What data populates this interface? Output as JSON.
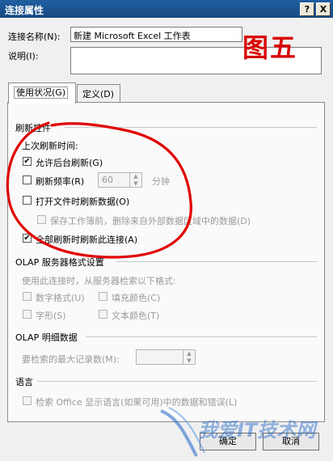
{
  "window": {
    "title": "连接属性",
    "help_button": "?",
    "close_button": "X"
  },
  "connection_name": {
    "label": "连接名称(N):",
    "value": "新建 Microsoft Excel 工作表"
  },
  "description": {
    "label": "说明(I):",
    "value": ""
  },
  "annotation": "图五",
  "tabs": [
    {
      "label": "使用状况(G)",
      "active": true
    },
    {
      "label": "定义(D)",
      "active": false
    }
  ],
  "refresh": {
    "group_title": "刷新控件",
    "last_refresh_label": "上次刷新时间:",
    "background_refresh": {
      "label": "允许后台刷新(G)",
      "checked": true
    },
    "refresh_every": {
      "label": "刷新频率(R)",
      "checked": false,
      "value": "60",
      "unit": "分钟"
    },
    "refresh_on_open": {
      "label": "打开文件时刷新数据(O)",
      "checked": false
    },
    "remove_external_data": {
      "label": "保存工作簿前，删除来自外部数据区域中的数据(D)",
      "checked": false,
      "disabled": true
    },
    "refresh_all": {
      "label": "全部刷新时刷新此连接(A)",
      "checked": true
    }
  },
  "olap_format": {
    "group_title": "OLAP 服务器格式设置",
    "description": "使用此连接时，从服务器检索以下格式:",
    "options": [
      {
        "label": "数字格式(U)",
        "checked": false
      },
      {
        "label": "填充颜色(C)",
        "checked": false
      },
      {
        "label": "字形(S)",
        "checked": false
      },
      {
        "label": "文本颜色(T)",
        "checked": false
      }
    ]
  },
  "olap_drill": {
    "group_title": "OLAP 明细数据",
    "max_records_label": "要检索的最大记录数(M):",
    "max_records_value": ""
  },
  "language": {
    "group_title": "语言",
    "office_language": {
      "label": "检索 Office 显示语言(如果可用)中的数据和错误(L)",
      "checked": false
    }
  },
  "buttons": {
    "ok": "确定",
    "cancel": "取消"
  },
  "watermark": "我爱IT技术网",
  "colors": {
    "title_bar": "#1a5591",
    "annotation_red": "#d80000",
    "watermark_blue": "#1e64c8"
  }
}
